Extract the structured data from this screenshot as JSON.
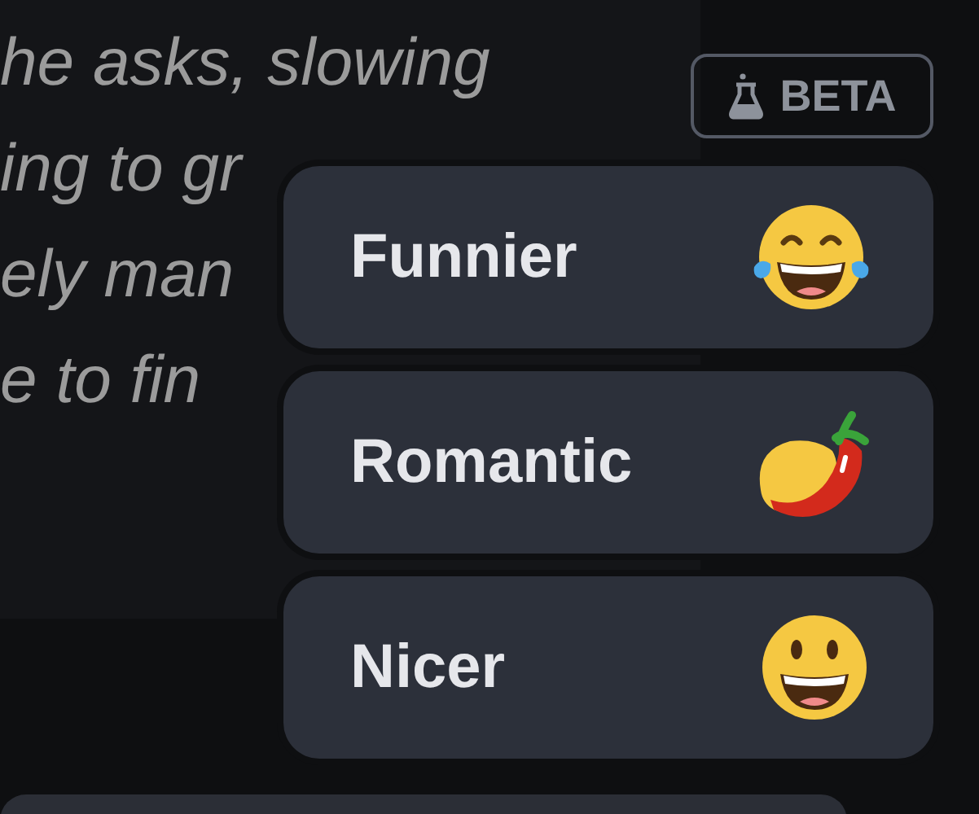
{
  "text_lines": [
    "he asks, slowing",
    "ing to gr",
    "ely man",
    "e to fin"
  ],
  "badge": {
    "label": "BETA"
  },
  "options": [
    {
      "label": "Funnier",
      "kind": "laugh"
    },
    {
      "label": "Romantic",
      "kind": "pepper"
    },
    {
      "label": "Nicer",
      "kind": "smile"
    }
  ]
}
